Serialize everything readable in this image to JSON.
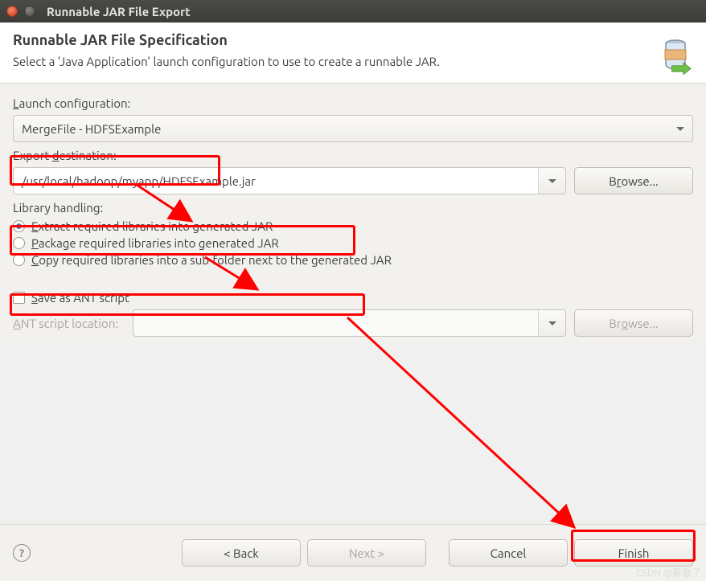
{
  "window": {
    "title": "Runnable JAR File Export"
  },
  "header": {
    "title": "Runnable JAR File Specification",
    "subtitle": "Select a 'Java Application' launch configuration to use to create a runnable JAR."
  },
  "form": {
    "launch_label": "Launch configuration:",
    "launch_value": "MergeFile - HDFSExample",
    "dest_label": "Export destination:",
    "dest_value": "/usr/local/hadoop/myapp/HDFSExample.jar",
    "browse_label": "Browse...",
    "lib_label": "Library handling:",
    "radio_extract": "Extract required libraries into generated JAR",
    "radio_package": "Package required libraries into generated JAR",
    "radio_copy": "Copy required libraries into a sub-folder next to the generated JAR",
    "save_ant": "Save as ANT script",
    "ant_loc_label": "ANT script location:",
    "browse2_label": "Browse..."
  },
  "footer": {
    "back": "< Back",
    "next": "Next >",
    "cancel": "Cancel",
    "finish": "Finish"
  },
  "watermark": "CSDN @雾散了"
}
